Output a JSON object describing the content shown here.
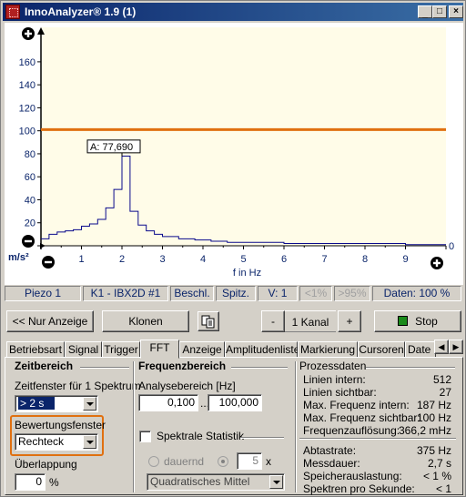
{
  "window": {
    "title": "InnoAnalyzer® 1.9 (1)"
  },
  "chart_data": {
    "type": "line",
    "xlabel": "f in Hz",
    "ylabel": "m/s²",
    "xlim": [
      0,
      10
    ],
    "ylim": [
      0,
      190
    ],
    "x_ticks": [
      "0",
      "1",
      "2",
      "3",
      "4",
      "5",
      "6",
      "7",
      "8",
      "9",
      "0"
    ],
    "y_ticks": [
      "0",
      "20",
      "40",
      "60",
      "80",
      "100",
      "120",
      "140",
      "160"
    ],
    "grid": false,
    "threshold_line": {
      "value": 101,
      "color": "#e07010"
    },
    "cursor_label": "A: 77,690",
    "cursor": {
      "x": 2.0,
      "y": 77.69
    },
    "series": [
      {
        "color": "#0a0a8c",
        "step": true,
        "x": [
          0.0,
          0.2,
          0.4,
          0.6,
          0.8,
          1.0,
          1.2,
          1.4,
          1.6,
          1.8,
          2.0,
          2.2,
          2.4,
          2.6,
          2.8,
          3.0,
          3.4,
          3.8,
          4.2,
          4.6,
          5.0,
          6.0,
          7.0,
          8.0,
          9.0,
          10.0
        ],
        "values": [
          6,
          10,
          12,
          13,
          14,
          17,
          19,
          23,
          33,
          49,
          78,
          30,
          18,
          13,
          10,
          8,
          6,
          5,
          4,
          3,
          3,
          2,
          2,
          2,
          1,
          1
        ]
      }
    ],
    "left_icons": [
      "plus-icon",
      "minus-icon"
    ]
  },
  "status": {
    "cells": [
      "Piezo 1",
      "K1 - IBX2D #1",
      "Beschl.",
      "Spitz.",
      "V: 1",
      "<1%",
      ">95%",
      "Daten: 100 %"
    ]
  },
  "buttons": {
    "nur_anzeige": "<< Nur Anzeige",
    "klonen": "Klonen",
    "minus": "-",
    "kanal": "1 Kanal",
    "plus": "+",
    "stop": "Stop",
    "stop_color": "#1a8a1a"
  },
  "tabs": [
    "Betriebsart",
    "Signal",
    "Trigger",
    "FFT",
    "Anzeige",
    "Amplitudenliste",
    "Markierung",
    "Cursoren",
    "Date"
  ],
  "active_tab": "FFT",
  "zeitbereich": {
    "title": "Zeitbereich",
    "zeitfenster_label": "Zeitfenster für 1 Spektrum",
    "zeitfenster_value": "> 2 s",
    "bewertung_label": "Bewertungsfenster",
    "bewertung_value": "Rechteck",
    "highlight_color": "#e07010",
    "ueberlappung_label": "Überlappung",
    "ueberlappung_value": "0",
    "ueberlappung_unit": "%"
  },
  "frequenzbereich": {
    "title": "Frequenzbereich",
    "analyse_label": "Analysebereich [Hz]",
    "from": "0,100",
    "sep": "...",
    "to": "100,000",
    "spektrale_label": "Spektrale Statistik",
    "dauernd_label": "dauernd",
    "count_value": "5",
    "count_unit": "x",
    "mittel_value": "Quadratisches Mittel"
  },
  "prozessdaten": {
    "title": "Prozessdaten",
    "rows1": [
      {
        "label": "Linien intern:",
        "value": "512"
      },
      {
        "label": "Linien sichtbar:",
        "value": "27"
      },
      {
        "label": "Max. Frequenz intern:",
        "value": "187 Hz"
      },
      {
        "label": "Max. Frequenz sichtbar:",
        "value": "100 Hz"
      },
      {
        "label": "Frequenzauflösung:",
        "value": "366,2 mHz"
      }
    ],
    "rows2": [
      {
        "label": "Abtastrate:",
        "value": "375 Hz"
      },
      {
        "label": "Messdauer:",
        "value": "2,7 s"
      },
      {
        "label": "Speicherauslastung:",
        "value": "< 1 %"
      },
      {
        "label": "Spektren pro Sekunde:",
        "value": "< 1"
      }
    ]
  }
}
